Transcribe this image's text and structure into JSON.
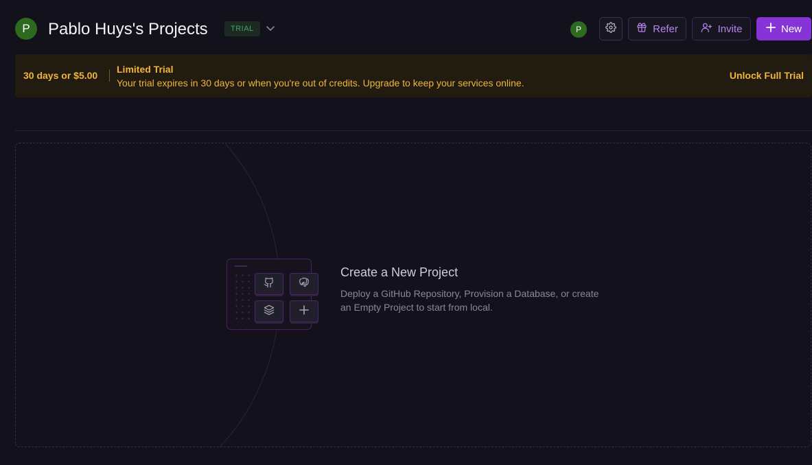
{
  "workspace": {
    "avatar_letter": "P",
    "title": "Pablo Huys's Projects",
    "badge": "TRIAL"
  },
  "toolbar": {
    "user_avatar_letter": "P",
    "refer_label": "Refer",
    "invite_label": "Invite",
    "new_label": "New"
  },
  "banner": {
    "price": "30 days or $5.00",
    "heading": "Limited Trial",
    "text": "Your trial expires in 30 days or when you're out of credits. Upgrade to keep your services online.",
    "unlock_label": "Unlock Full Trial"
  },
  "empty_state": {
    "title": "Create a New Project",
    "description": "Deploy a GitHub Repository, Provision a Database, or create an Empty Project to start from local.",
    "tiles": [
      "github-icon",
      "postgres-icon",
      "layers-icon",
      "plus-icon"
    ]
  },
  "colors": {
    "background": "#13111c",
    "accent": "#8734d6",
    "accent_text": "#b585f3",
    "banner_text": "#f0b53c",
    "banner_bg": "#221c10",
    "avatar_green": "#2c6a1f",
    "trial_green": "#3fa66a"
  }
}
